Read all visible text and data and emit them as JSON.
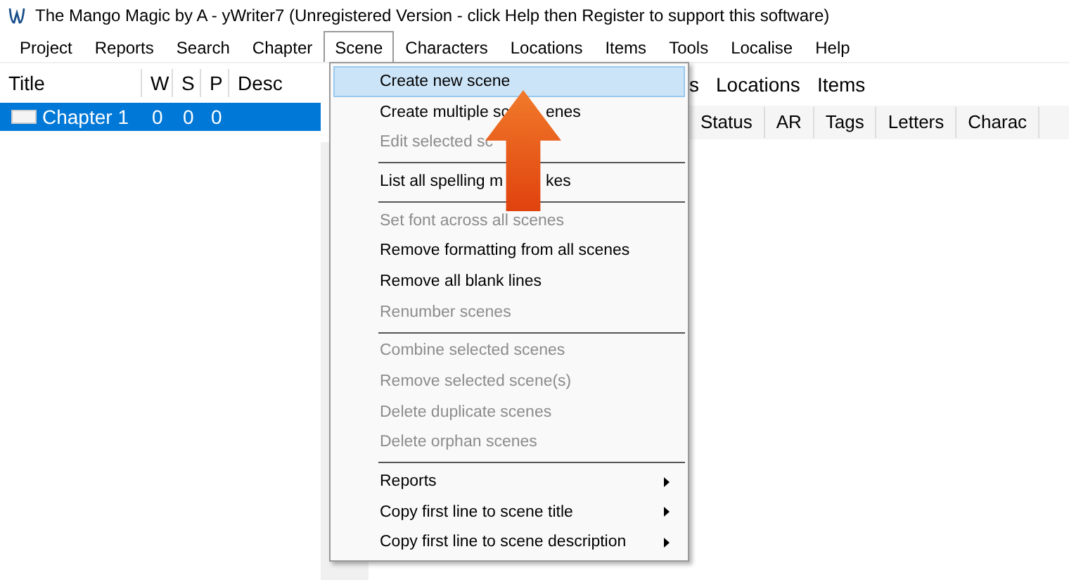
{
  "window": {
    "title": "The Mango Magic by A - yWriter7 (Unregistered Version - click Help then Register to support this software)"
  },
  "menu_bar": [
    {
      "label": "Project",
      "selected": false
    },
    {
      "label": "Reports",
      "selected": false
    },
    {
      "label": "Search",
      "selected": false
    },
    {
      "label": "Chapter",
      "selected": false
    },
    {
      "label": "Scene",
      "selected": true
    },
    {
      "label": "Characters",
      "selected": false
    },
    {
      "label": "Locations",
      "selected": false
    },
    {
      "label": "Items",
      "selected": false
    },
    {
      "label": "Tools",
      "selected": false
    },
    {
      "label": "Localise",
      "selected": false
    },
    {
      "label": "Help",
      "selected": false
    }
  ],
  "chapter_list": {
    "columns": [
      "Title",
      "W",
      "S",
      "P",
      "Desc"
    ],
    "rows": [
      {
        "title": "Chapter 1",
        "w": "0",
        "s": "0",
        "p": "0",
        "selected": true
      }
    ]
  },
  "scene_tabs": [
    "s",
    "Locations",
    "Items"
  ],
  "scene_columns": [
    "Status",
    "AR",
    "Tags",
    "Letters",
    "Charac"
  ],
  "scene_menu": [
    {
      "kind": "item",
      "label": "Create new scene",
      "selected": true,
      "disabled": false,
      "submenu": false
    },
    {
      "kind": "item",
      "label": "Create multiple sc",
      "tail": "enes",
      "selected": false,
      "disabled": false,
      "submenu": false
    },
    {
      "kind": "item",
      "label": "Edit selected sc",
      "selected": false,
      "disabled": true,
      "submenu": false
    },
    {
      "kind": "separator"
    },
    {
      "kind": "item",
      "label": "List all spelling m",
      "tail": "kes",
      "selected": false,
      "disabled": false,
      "submenu": false
    },
    {
      "kind": "separator"
    },
    {
      "kind": "item",
      "label": "Set font across all scenes",
      "selected": false,
      "disabled": true,
      "submenu": false
    },
    {
      "kind": "item",
      "label": "Remove formatting from all scenes",
      "selected": false,
      "disabled": false,
      "submenu": false
    },
    {
      "kind": "item",
      "label": "Remove all blank lines",
      "selected": false,
      "disabled": false,
      "submenu": false
    },
    {
      "kind": "item",
      "label": "Renumber scenes",
      "selected": false,
      "disabled": true,
      "submenu": false
    },
    {
      "kind": "separator"
    },
    {
      "kind": "item",
      "label": "Combine selected scenes",
      "selected": false,
      "disabled": true,
      "submenu": false
    },
    {
      "kind": "item",
      "label": "Remove selected scene(s)",
      "selected": false,
      "disabled": true,
      "submenu": false
    },
    {
      "kind": "item",
      "label": "Delete duplicate scenes",
      "selected": false,
      "disabled": true,
      "submenu": false
    },
    {
      "kind": "item",
      "label": "Delete orphan scenes",
      "selected": false,
      "disabled": true,
      "submenu": false
    },
    {
      "kind": "separator"
    },
    {
      "kind": "item",
      "label": "Reports",
      "selected": false,
      "disabled": false,
      "submenu": true
    },
    {
      "kind": "item",
      "label": "Copy first line to scene title",
      "selected": false,
      "disabled": false,
      "submenu": true
    },
    {
      "kind": "item",
      "label": "Copy first line to scene description",
      "selected": false,
      "disabled": false,
      "submenu": true
    }
  ]
}
